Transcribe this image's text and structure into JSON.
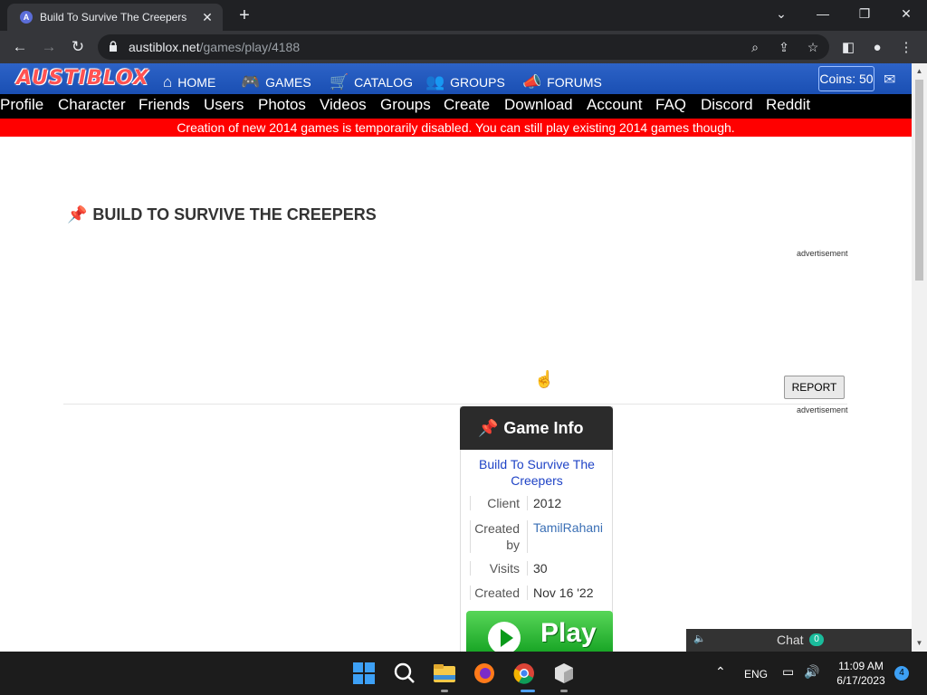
{
  "browser": {
    "tab_title": "Build To Survive The Creepers",
    "url_domain": "austiblox.net",
    "url_path": "/games/play/4188"
  },
  "site": {
    "logo_text": "AUSTIBLOX",
    "nav": [
      {
        "label": "HOME",
        "icon": "home-icon"
      },
      {
        "label": "GAMES",
        "icon": "gamepad-icon"
      },
      {
        "label": "CATALOG",
        "icon": "cart-icon"
      },
      {
        "label": "GROUPS",
        "icon": "users-icon"
      },
      {
        "label": "FORUMS",
        "icon": "megaphone-icon"
      }
    ],
    "coins": "Coins: 50",
    "subnav": [
      "Profile",
      "Character",
      "Friends",
      "Users",
      "Photos",
      "Videos",
      "Groups",
      "Create",
      "Download",
      "Account",
      "FAQ",
      "Discord",
      "Reddit"
    ],
    "banner": "Creation of new 2014 games is temporarily disabled. You can still play existing 2014 games though."
  },
  "game": {
    "title": "BUILD TO SURVIVE THE CREEPERS",
    "ad_label": "advertisement",
    "report_label": "REPORT",
    "info_heading": "Game Info",
    "name": "Build To Survive The Creepers",
    "client_label": "Client",
    "client_value": "2012",
    "created_by_label": "Created by",
    "created_by_value": "TamilRahani",
    "visits_label": "Visits",
    "visits_value": "30",
    "created_label": "Created",
    "created_value": "Nov 16 '22",
    "play_label": "Play"
  },
  "chat": {
    "label": "Chat",
    "count": "0"
  },
  "taskbar": {
    "language": "ENG",
    "time": "11:09 AM",
    "date": "6/17/2023",
    "notifications": "4"
  }
}
